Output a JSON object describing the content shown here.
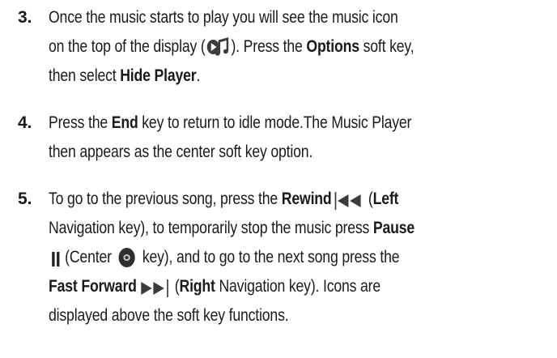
{
  "steps": [
    {
      "number": "3.",
      "lines": [
        {
          "t1": "Once the music starts to play you will see the music icon"
        },
        {
          "t1": "on the top of the display (",
          "icon": "music-icon",
          "t2": "). Press the ",
          "b1": "Options",
          "t3": " soft key,"
        },
        {
          "t1": "then select ",
          "b1": "Hide Player",
          "t2": "."
        }
      ]
    },
    {
      "number": "4.",
      "lines": [
        {
          "t1": "Press the ",
          "b1": "End",
          "t2": " key to return to idle mode.The Music Player"
        },
        {
          "t1": "then appears as the center soft key option."
        }
      ]
    },
    {
      "number": "5.",
      "lines": [
        {
          "t1": "To go to the previous song, press the ",
          "b1": "Rewind",
          "icon": "rewind-icon",
          "t2": "(",
          "b2": "Left"
        },
        {
          "t1": "Navigation key), to temporarily stop the music press ",
          "b1": "Pause"
        },
        {
          "icon": "pause-icon",
          "t1": "(Center ",
          "icon2": "center-key-icon",
          "t2": " key), and to go to the next song press the"
        },
        {
          "b1": "Fast Forward",
          "icon": "fast-forward-icon",
          "t1": "(",
          "b2": "Right",
          "t2": " Navigation key). Icons are"
        },
        {
          "t1": "displayed above the soft key functions."
        }
      ]
    }
  ],
  "colors": {
    "text": "#1a1a1a",
    "icon": "#3c3c3c",
    "icon_light": "#c8c8c8"
  }
}
